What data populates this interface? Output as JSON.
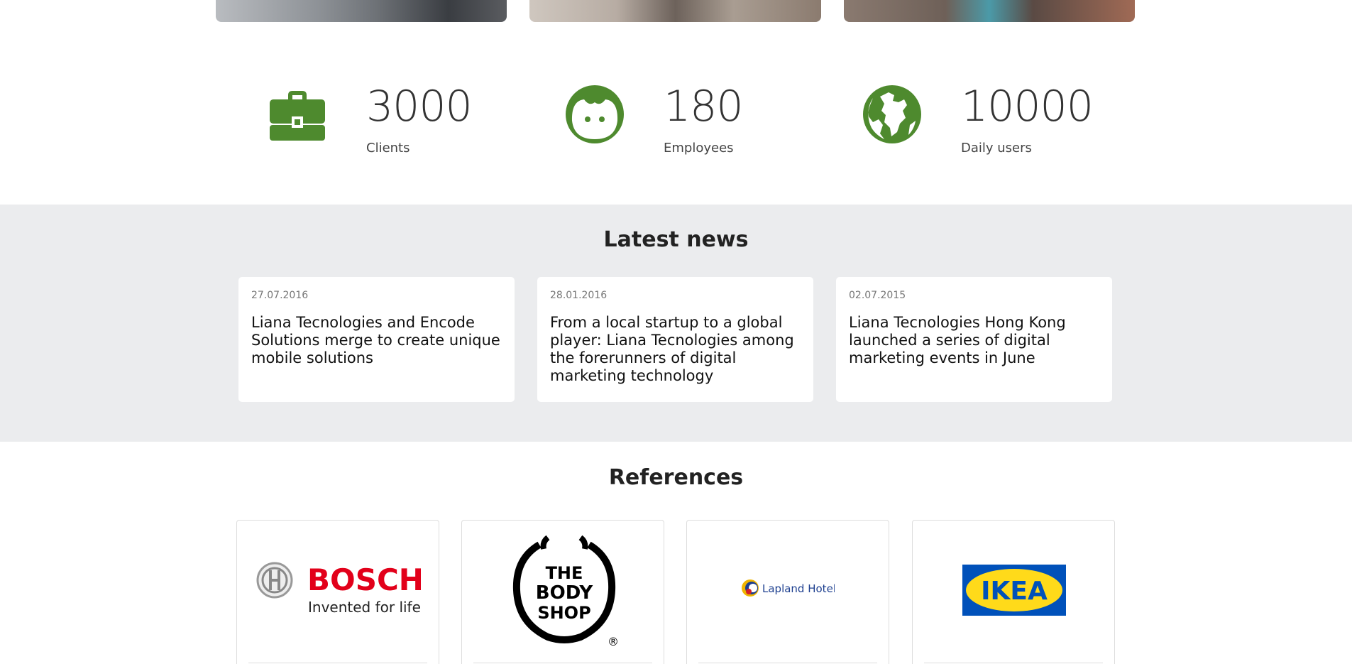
{
  "stats": [
    {
      "icon": "briefcase-icon",
      "value": "3000",
      "label": "Clients"
    },
    {
      "icon": "face-icon",
      "value": "180",
      "label": "Employees"
    },
    {
      "icon": "globe-icon",
      "value": "10000",
      "label": "Daily users"
    }
  ],
  "news": {
    "title": "Latest news",
    "items": [
      {
        "date": "27.07.2016",
        "headline": "Liana Tecnologies and Encode Solutions merge to create unique mobile solutions"
      },
      {
        "date": "28.01.2016",
        "headline": "From a local startup to a global player: Liana Tecnologies among the forerunners of digital marketing technology"
      },
      {
        "date": "02.07.2015",
        "headline": "Liana Tecnologies Hong Kong launched a series of digital marketing events in June"
      }
    ]
  },
  "references": {
    "title": "References",
    "logos": [
      {
        "name": "BOSCH",
        "tagline": "Invented for life"
      },
      {
        "name": "THE BODY SHOP",
        "line1": "THE",
        "line2": "BODY",
        "line3": "SHOP",
        "mark": "®"
      },
      {
        "name": "Lapland Hotels"
      },
      {
        "name": "IKEA"
      }
    ]
  },
  "colors": {
    "accent": "#4e8a2e",
    "bosch_red": "#e2001a",
    "ikea_blue": "#0051ba",
    "ikea_yellow": "#ffda1a",
    "lapland_blue": "#1d3f8f"
  }
}
